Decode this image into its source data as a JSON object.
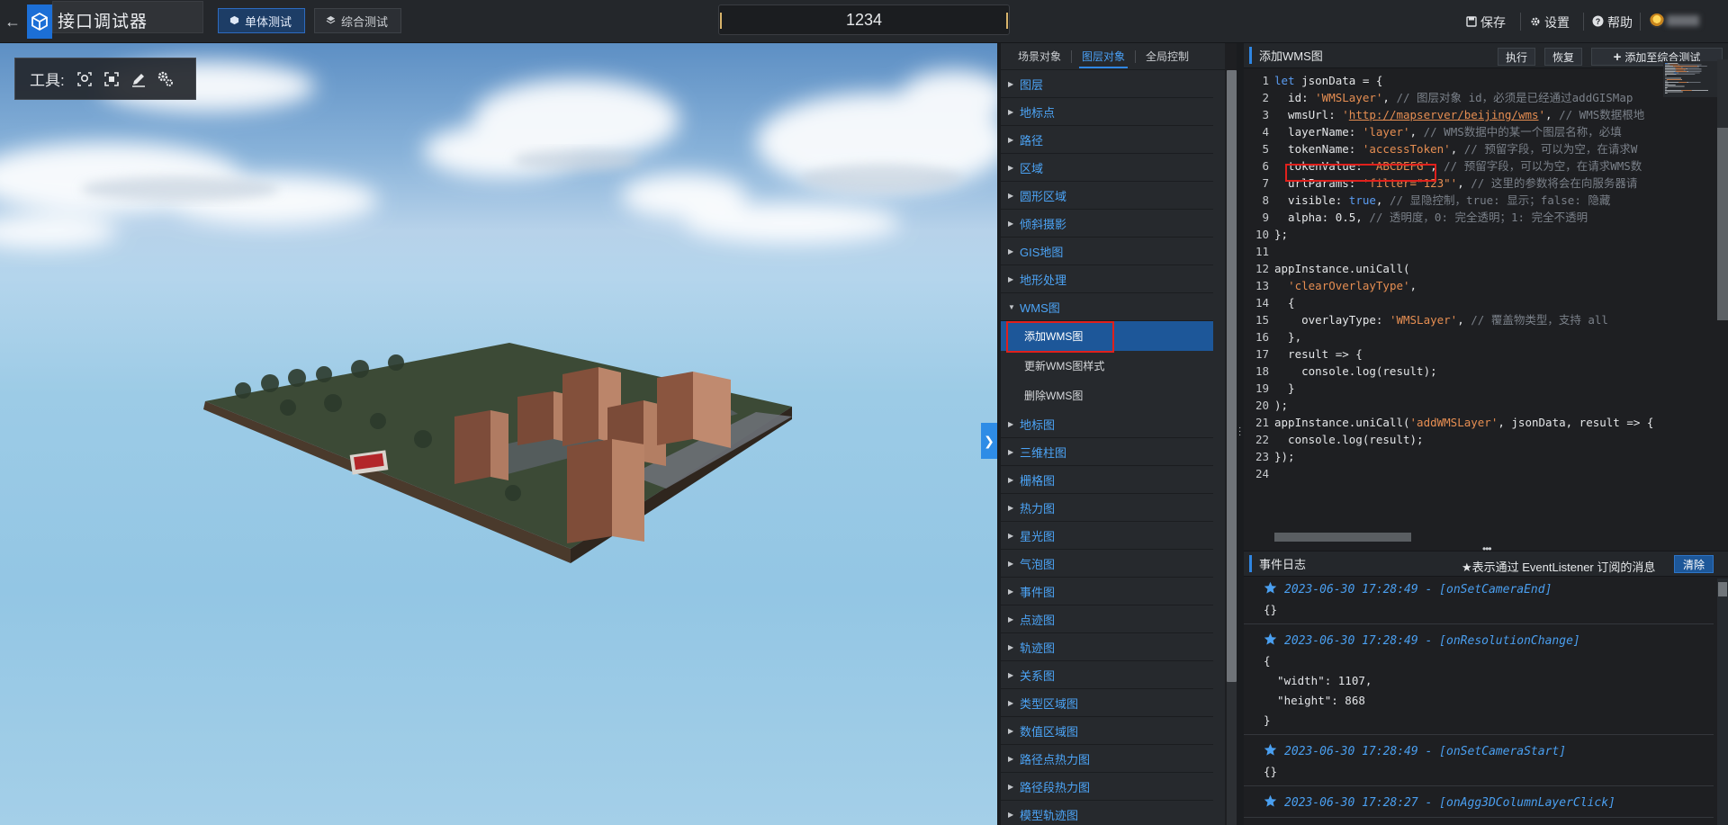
{
  "topbar": {
    "app_title": "接口调试器",
    "mode_single": "单体测试",
    "mode_combined": "综合测试",
    "title_value": "1234",
    "save": "保存",
    "settings": "设置",
    "help": "帮助"
  },
  "viewport": {
    "tools_label": "工具:",
    "tool_icons": [
      "locate-icon",
      "frame-select-icon",
      "pen-icon",
      "settings-gear-icon"
    ]
  },
  "mid": {
    "tabs": [
      "场景对象",
      "图层对象",
      "全局控制"
    ],
    "active_tab": "图层对象",
    "tree": [
      {
        "label": "图层"
      },
      {
        "label": "地标点"
      },
      {
        "label": "路径"
      },
      {
        "label": "区域"
      },
      {
        "label": "圆形区域"
      },
      {
        "label": "倾斜摄影"
      },
      {
        "label": "GIS地图"
      },
      {
        "label": "地形处理"
      },
      {
        "label": "WMS图",
        "expanded": true
      }
    ],
    "wms_children": [
      "添加WMS图",
      "更新WMS图样式",
      "删除WMS图"
    ],
    "tree_after": [
      {
        "label": "地标图"
      },
      {
        "label": "三维柱图"
      },
      {
        "label": "栅格图"
      },
      {
        "label": "热力图"
      },
      {
        "label": "星光图"
      },
      {
        "label": "气泡图"
      },
      {
        "label": "事件图"
      },
      {
        "label": "点迹图"
      },
      {
        "label": "轨迹图"
      },
      {
        "label": "关系图"
      },
      {
        "label": "类型区域图"
      },
      {
        "label": "数值区域图"
      },
      {
        "label": "路径点热力图"
      },
      {
        "label": "路径段热力图"
      },
      {
        "label": "模型轨迹图"
      }
    ]
  },
  "code": {
    "title": "添加WMS图",
    "run": "执行",
    "restore": "恢复",
    "add_to_suite": "添加至综合测试",
    "lines": [
      [
        [
          "kw",
          "let"
        ],
        [
          "t",
          " jsonData = {"
        ]
      ],
      [
        [
          "t",
          "  id: "
        ],
        [
          "str",
          "'WMSLayer'"
        ],
        [
          "t",
          ", "
        ],
        [
          "cmt",
          "// 图层对象 id，必须是已经通过addGISMap"
        ]
      ],
      [
        [
          "t",
          "  wmsUrl: "
        ],
        [
          "str",
          "'"
        ],
        [
          "url",
          "http://mapserver/beijing/wms"
        ],
        [
          "str",
          "'"
        ],
        [
          "t",
          ", "
        ],
        [
          "cmt",
          "// WMS数据根地"
        ]
      ],
      [
        [
          "t",
          "  layerName: "
        ],
        [
          "str",
          "'layer'"
        ],
        [
          "t",
          ", "
        ],
        [
          "cmt",
          "// WMS数据中的某一个图层名称，必填"
        ]
      ],
      [
        [
          "t",
          "  tokenName: "
        ],
        [
          "str",
          "'accessToken'"
        ],
        [
          "t",
          ", "
        ],
        [
          "cmt",
          "// 预留字段，可以为空，在请求W"
        ]
      ],
      [
        [
          "t",
          "  tokenValue: "
        ],
        [
          "str",
          "'ABCDEFG'"
        ],
        [
          "t",
          ", "
        ],
        [
          "cmt",
          "// 预留字段，可以为空，在请求WMS数"
        ]
      ],
      [
        [
          "t",
          "  urlParams: "
        ],
        [
          "str",
          "'filter=\"123\"'"
        ],
        [
          "t",
          ", "
        ],
        [
          "cmt",
          "// 这里的参数将会在向服务器请"
        ]
      ],
      [
        [
          "t",
          "  visible: "
        ],
        [
          "kw",
          "true"
        ],
        [
          "t",
          ", "
        ],
        [
          "cmt",
          "// 显隐控制，true: 显示；false: 隐藏"
        ]
      ],
      [
        [
          "t",
          "  alpha: 0.5, "
        ],
        [
          "cmt",
          "// 透明度，0: 完全透明；1: 完全不透明"
        ]
      ],
      [
        [
          "t",
          "};"
        ]
      ],
      [
        [
          "t",
          ""
        ]
      ],
      [
        [
          "t",
          "appInstance.uniCall("
        ]
      ],
      [
        [
          "t",
          "  "
        ],
        [
          "str",
          "'clearOverlayType'"
        ],
        [
          "t",
          ","
        ]
      ],
      [
        [
          "t",
          "  {"
        ]
      ],
      [
        [
          "t",
          "    overlayType: "
        ],
        [
          "str",
          "'WMSLayer'"
        ],
        [
          "t",
          ", "
        ],
        [
          "cmt",
          "// 覆盖物类型，支持 all"
        ]
      ],
      [
        [
          "t",
          "  },"
        ]
      ],
      [
        [
          "t",
          "  result => {"
        ]
      ],
      [
        [
          "t",
          "    console.log(result);"
        ]
      ],
      [
        [
          "t",
          "  }"
        ]
      ],
      [
        [
          "t",
          ");"
        ]
      ],
      [
        [
          "t",
          "appInstance.uniCall("
        ],
        [
          "str",
          "'addWMSLayer'"
        ],
        [
          "t",
          ", jsonData, result => {"
        ]
      ],
      [
        [
          "t",
          "  console.log(result);"
        ]
      ],
      [
        [
          "t",
          "});"
        ]
      ],
      [
        [
          "t",
          ""
        ]
      ]
    ]
  },
  "log": {
    "title": "事件日志",
    "hint": "★表示通过 EventListener 订阅的消息",
    "clear": "清除",
    "entries": [
      {
        "head": "2023-06-30 17:28:49 - [onSetCameraEnd]",
        "body": [
          "{}"
        ]
      },
      {
        "head": "2023-06-30 17:28:49 - [onResolutionChange]",
        "body": [
          "{",
          "  \"width\": 1107,",
          "  \"height\": 868",
          "}"
        ]
      },
      {
        "head": "2023-06-30 17:28:49 - [onSetCameraStart]",
        "body": [
          "{}"
        ]
      },
      {
        "head": "2023-06-30 17:28:27 - [onAgg3DColumnLayerClick]",
        "body": []
      }
    ]
  },
  "colors": {
    "accent": "#2f86e3",
    "highlight_box": "#e0201c",
    "tree_link": "#4ca4f6"
  }
}
